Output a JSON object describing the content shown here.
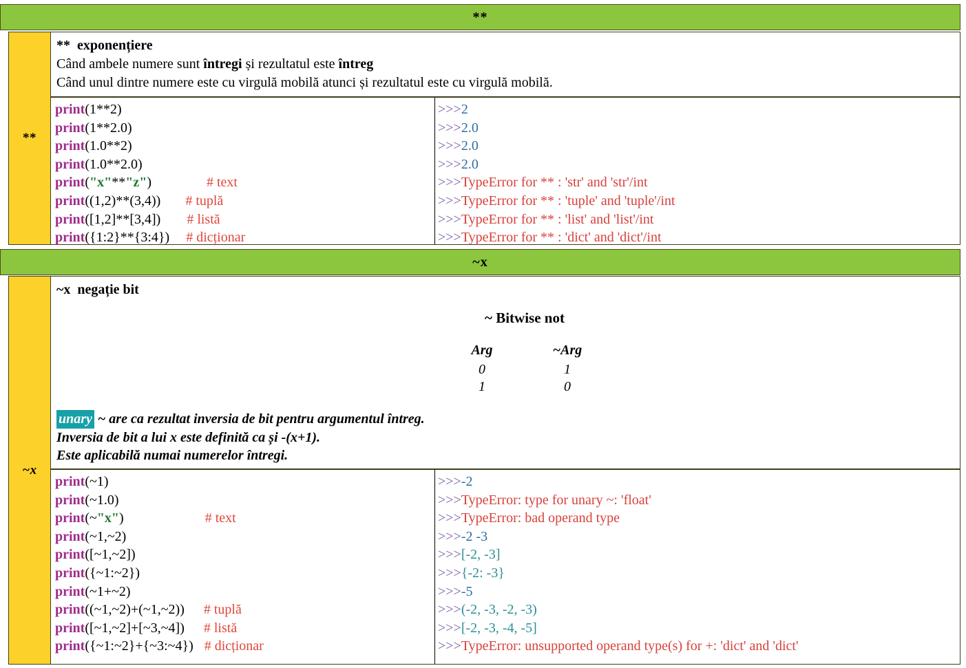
{
  "sections": [
    {
      "band_label": "**",
      "rail_label": "**",
      "title_symbol": "**",
      "title_name": "exponențiere",
      "desc_lines": [
        "Când ambele numere sunt întregi și rezultatul este întreg",
        "Când unul dintre numere este cu virgulă mobilă atunci și rezultatul este cu virgulă mobilă."
      ],
      "rows": [
        {
          "code": "print(1**2)",
          "comment": "",
          "prompt": ">>>",
          "out": "2",
          "out_kind": "num"
        },
        {
          "code": "print(1**2.0)",
          "comment": "",
          "prompt": ">>>",
          "out": "2.0",
          "out_kind": "num"
        },
        {
          "code": "print(1.0**2)",
          "comment": "",
          "prompt": ">>>",
          "out": "2.0",
          "out_kind": "num"
        },
        {
          "code": "print(1.0**2.0)",
          "comment": "",
          "prompt": ">>>",
          "out": "2.0",
          "out_kind": "num"
        },
        {
          "code": "print(\"x\"**\"z\")",
          "comment": "# text",
          "prompt": ">>>",
          "out": "TypeError for ** : 'str' and 'str'/int",
          "out_kind": "err"
        },
        {
          "code": "print((1,2)**(3,4))",
          "comment": "# tuplă",
          "prompt": ">>>",
          "out": "TypeError for ** : 'tuple' and 'tuple'/int",
          "out_kind": "err"
        },
        {
          "code": "print([1,2]**[3,4])",
          "comment": "# listă",
          "prompt": ">>>",
          "out": "TypeError for ** : 'list' and 'list'/int",
          "out_kind": "err"
        },
        {
          "code": "print({1:2}**{3:4})",
          "comment": "# dicționar",
          "prompt": ">>>",
          "out": "TypeError for ** : 'dict' and 'dict'/int",
          "out_kind": "err"
        }
      ]
    },
    {
      "band_label": "~x",
      "rail_label": "~x",
      "title_symbol": "~x",
      "title_name": "negație bit",
      "truth_table": {
        "title": "~ Bitwise not",
        "headers": [
          "Arg",
          "~Arg"
        ],
        "rows": [
          [
            "0",
            "1"
          ],
          [
            "1",
            "0"
          ]
        ]
      },
      "notes": {
        "badge": "unary",
        "lines": [
          "~ are ca rezultat inversia de bit pentru argumentul întreg.",
          "Inversia de bit a lui x este definită ca și -(x+1).",
          "Este aplicabilă numai numerelor întregi."
        ]
      },
      "rows": [
        {
          "code": "print(~1)",
          "comment": "",
          "prompt": ">>>",
          "out": "-2",
          "out_kind": "num"
        },
        {
          "code": "print(~1.0)",
          "comment": "",
          "prompt": ">>>",
          "out": "TypeError: type for unary ~: 'float'",
          "out_kind": "err"
        },
        {
          "code": "print(~\"x\")",
          "comment": "# text",
          "prompt": ">>>",
          "out": "TypeError: bad operand type",
          "out_kind": "err"
        },
        {
          "code": "print(~1,~2)",
          "comment": "",
          "prompt": ">>>",
          "out": "-2 -3",
          "out_kind": "num"
        },
        {
          "code": "print([~1,~2])",
          "comment": "",
          "prompt": ">>>",
          "out": "[-2, -3]",
          "out_kind": "teal"
        },
        {
          "code": "print({~1:~2})",
          "comment": "",
          "prompt": ">>>",
          "out": "{-2: -3}",
          "out_kind": "teal"
        },
        {
          "code": "print(~1+~2)",
          "comment": "",
          "prompt": ">>>",
          "out": "-5",
          "out_kind": "num"
        },
        {
          "code": "print((~1,~2)+(~1,~2))",
          "comment": "# tuplă",
          "prompt": ">>>",
          "out": "(-2, -3, -2, -3)",
          "out_kind": "teal"
        },
        {
          "code": "print([~1,~2]+[~3,~4])",
          "comment": "# listă",
          "prompt": ">>>",
          "out": "[-2, -3, -4, -5]",
          "out_kind": "teal"
        },
        {
          "code": "print({~1:~2}+{~3:~4})",
          "comment": "# dicționar",
          "prompt": ">>>",
          "out": "TypeError: unsupported operand type(s) for +: 'dict' and 'dict'",
          "out_kind": "err"
        }
      ]
    }
  ],
  "colors": {
    "band_green": "#8cc63e",
    "rail_yellow": "#fcd129",
    "keyword_magenta": "#a12a8c",
    "string_green": "#1f7a34",
    "comment_red": "#e0463a",
    "prompt_purple": "#7b5aa6",
    "number_blue": "#2e6da4",
    "error_red": "#d6413b",
    "teal": "#2a8f96",
    "badge_teal": "#16a0a8"
  }
}
